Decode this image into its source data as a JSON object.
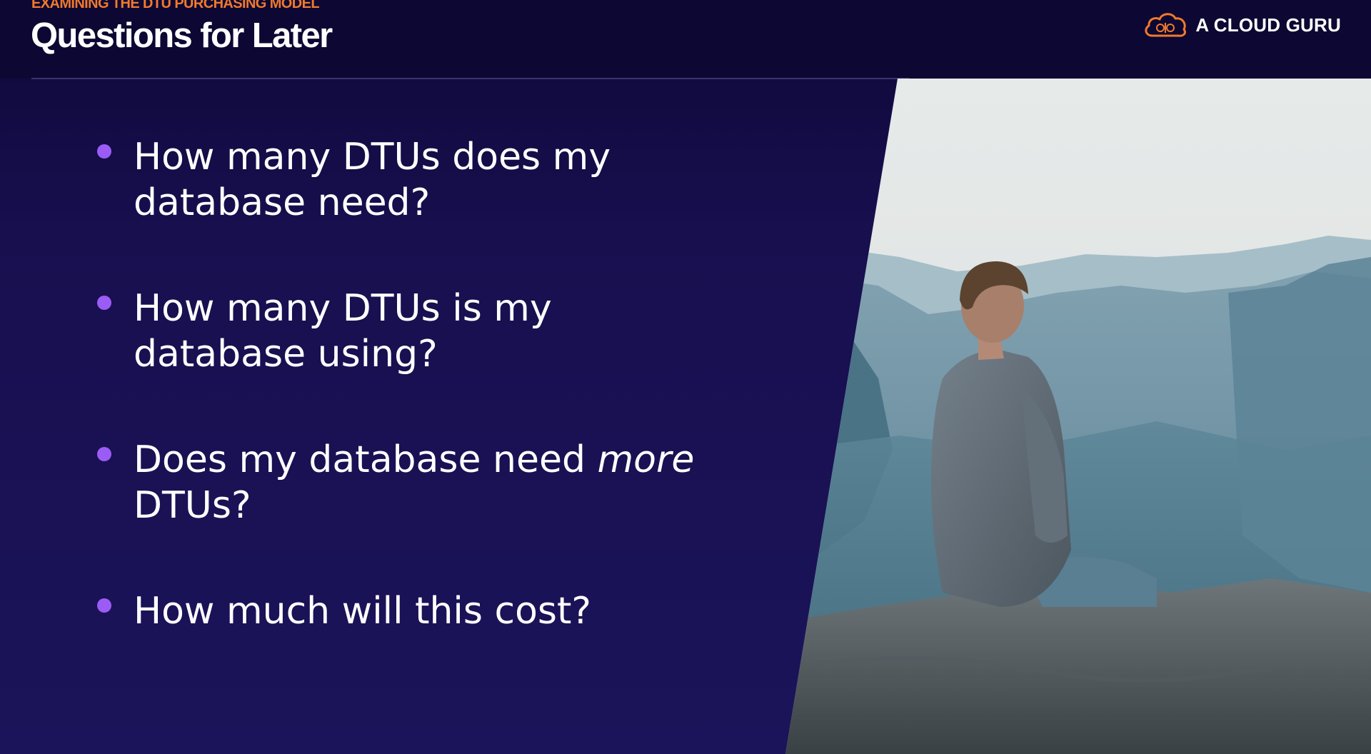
{
  "header": {
    "kicker": "EXAMINING THE DTU PURCHASING MODEL",
    "title": "Questions for Later"
  },
  "brand": {
    "name": "A CLOUD GURU",
    "logo_icon": "cloud-logo-icon",
    "accent_color": "#f07a2c"
  },
  "bullets": [
    {
      "line1": "How many DTUs does my",
      "line2": "database need?"
    },
    {
      "line1": "How many DTUs is my",
      "line2": "database using?"
    },
    {
      "line1_pre": "Does my database need ",
      "line1_em": "more",
      "line2": "DTUs?"
    },
    {
      "line1": "How much will this cost?"
    }
  ],
  "colors": {
    "background": "#170f4e",
    "bullet_dot": "#9b5cf6",
    "text": "#ffffff"
  }
}
